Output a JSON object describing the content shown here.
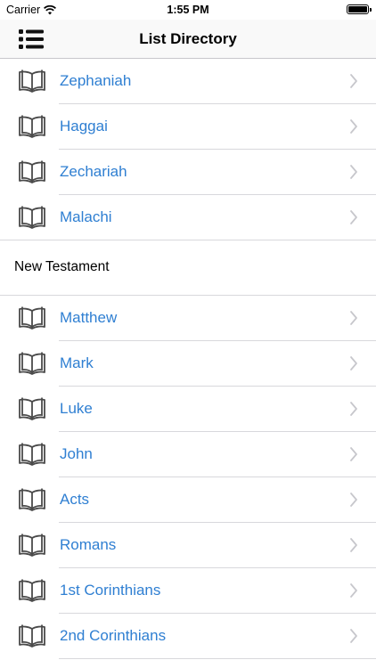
{
  "status": {
    "carrier": "Carrier",
    "time": "1:55 PM"
  },
  "nav": {
    "title": "List Directory",
    "menu_icon": "list-menu-icon"
  },
  "old_testament_tail": [
    {
      "label": "Zephaniah"
    },
    {
      "label": "Haggai"
    },
    {
      "label": "Zechariah"
    },
    {
      "label": "Malachi"
    }
  ],
  "new_testament": {
    "header": "New Testament",
    "items": [
      {
        "label": "Matthew"
      },
      {
        "label": "Mark"
      },
      {
        "label": "Luke"
      },
      {
        "label": "John"
      },
      {
        "label": "Acts"
      },
      {
        "label": "Romans"
      },
      {
        "label": "1st Corinthians"
      },
      {
        "label": "2nd Corinthians"
      }
    ]
  },
  "colors": {
    "link": "#2f7fd2",
    "separator": "#d8d8dc",
    "icon": "#4a4a4a",
    "chevron": "#c7c7cc"
  }
}
